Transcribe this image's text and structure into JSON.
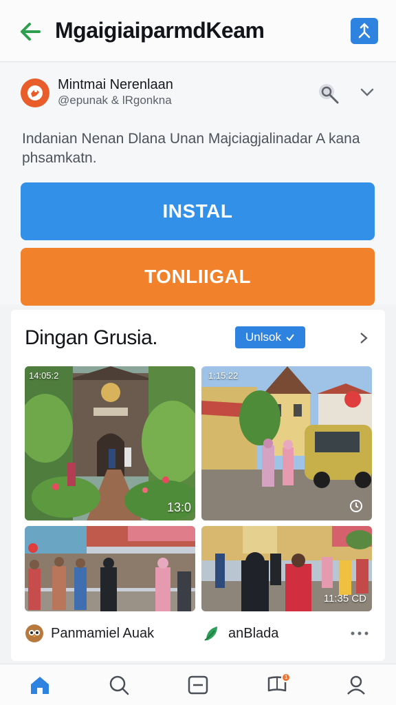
{
  "header": {
    "title": "MgaigiaiparmdKeam",
    "back_icon": "arrow-left-icon",
    "share_icon": "share-icon",
    "accent_color": "#2e9e4f"
  },
  "app": {
    "name": "Mintmai Nerenlaan",
    "handle": "@epunak & lRgonkna",
    "description": "Indanian Nenan Dlana Unan Majciagjalinadar A kana phsamkatn."
  },
  "actions": {
    "install_label": "INSTAL",
    "download_label": "TONLIIGAL",
    "install_color": "#3390e8",
    "download_color": "#f2812c"
  },
  "gallery": {
    "title": "Dingan Grusia.",
    "badge_label": "Unlsok",
    "photos": [
      {
        "status_time": "14:05:2",
        "counter": "13:0",
        "scene": "garden-courtyard"
      },
      {
        "status_time": "1:15:22",
        "counter": "",
        "scene": "street-car"
      },
      {
        "status_time": "",
        "counter": "",
        "scene": "market-crowd"
      },
      {
        "status_time": "",
        "counter": "11:35 CD",
        "scene": "street-crowd"
      }
    ],
    "authors": [
      {
        "name": "Panmamiel Auak",
        "icon": "owl-avatar-icon"
      },
      {
        "name": "anBlada",
        "icon": "leaf-icon"
      }
    ]
  },
  "bottom_nav": {
    "items": [
      {
        "name": "home",
        "icon": "home-icon",
        "active": true
      },
      {
        "name": "search",
        "icon": "search-icon",
        "active": false
      },
      {
        "name": "media",
        "icon": "media-icon",
        "active": false
      },
      {
        "name": "messages",
        "icon": "chat-icon",
        "active": false,
        "badge": "1"
      },
      {
        "name": "profile",
        "icon": "profile-icon",
        "active": false
      }
    ]
  }
}
